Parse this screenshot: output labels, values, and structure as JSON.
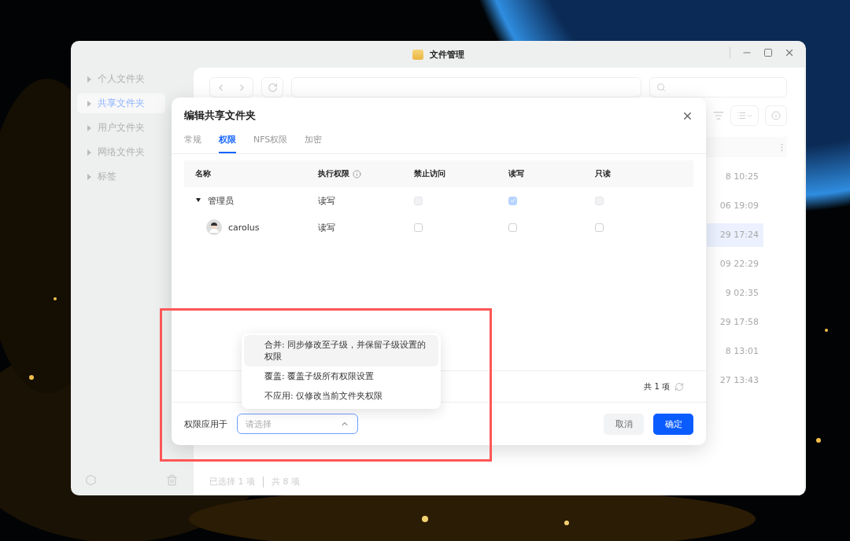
{
  "window": {
    "title": "文件管理"
  },
  "sidebar": {
    "items": [
      {
        "label": "个人文件夹",
        "selected": false
      },
      {
        "label": "共享文件夹",
        "selected": true
      },
      {
        "label": "用户文件夹",
        "selected": false
      },
      {
        "label": "网络文件夹",
        "selected": false
      },
      {
        "label": "标签",
        "selected": false
      }
    ]
  },
  "file_list": {
    "rows": [
      {
        "modified": "8 10:25",
        "selected": false
      },
      {
        "modified": "06 19:09",
        "selected": false
      },
      {
        "modified": "29 17:24",
        "selected": true
      },
      {
        "modified": "09 22:29",
        "selected": false
      },
      {
        "modified": "9 02:35",
        "selected": false
      },
      {
        "modified": "29 17:58",
        "selected": false
      },
      {
        "modified": "8 13:01",
        "selected": false
      },
      {
        "modified": "27 13:43",
        "selected": false
      }
    ]
  },
  "status_bar": {
    "selected_count": "已选择 1 项",
    "total": "共 8 项"
  },
  "dialog": {
    "title": "编辑共享文件夹",
    "tabs": [
      {
        "label": "常规",
        "selected": false
      },
      {
        "label": "权限",
        "selected": true
      },
      {
        "label": "NFS权限",
        "selected": false
      },
      {
        "label": "加密",
        "selected": false
      }
    ],
    "table": {
      "columns": [
        "名称",
        "执行权限",
        "禁止访问",
        "读写",
        "只读"
      ],
      "rows": [
        {
          "name": "管理员",
          "permission": "读写",
          "deny": false,
          "read_write": true,
          "read_only": false,
          "disabled": true,
          "expanded": true,
          "children": [
            {
              "name": "carolus",
              "permission": "读写",
              "deny": false,
              "read_write": false,
              "read_only": false,
              "disabled": false
            }
          ]
        }
      ]
    },
    "count": "共 1 项",
    "apply_label": "权限应用于",
    "apply_select": {
      "placeholder": "请选择",
      "open": true,
      "options": [
        {
          "label": "合并: 同步修改至子级，并保留子级设置的权限",
          "highlighted": true
        },
        {
          "label": "覆盖: 覆盖子级所有权限设置",
          "highlighted": false
        },
        {
          "label": "不应用: 仅修改当前文件夹权限",
          "highlighted": false
        }
      ]
    },
    "buttons": [
      {
        "label": "取消",
        "kind": "secondary"
      },
      {
        "label": "确定",
        "kind": "primary"
      }
    ]
  }
}
